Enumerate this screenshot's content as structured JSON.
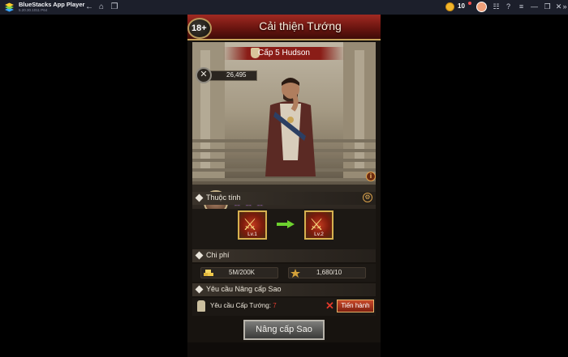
{
  "emulator": {
    "title": "BlueStacks App Player",
    "version": "5.20.30.1011 P64",
    "coins": "10",
    "nav_icons": [
      "back-icon",
      "home-icon",
      "multi-instance-icon"
    ],
    "controls": [
      "coin-icon",
      "notification-dot",
      "avatar",
      "menu-icon",
      "help-icon",
      "hamburger-icon",
      "minimize-icon",
      "restore-icon",
      "close-icon",
      "expand-icon"
    ]
  },
  "game": {
    "title": "Cải thiện Tướng",
    "age_rating": "18+",
    "hero": {
      "level_name": "Cấp 5 Hudson",
      "power": "26,495",
      "stars": 3
    },
    "attributes": {
      "header": "Thuộc tính",
      "from_level": "Lv.1",
      "to_level": "Lv.2"
    },
    "cost": {
      "header": "Chi phí",
      "gold": "5M/200K",
      "medals": "1,680/10"
    },
    "requirement": {
      "header": "Yêu cầu Nâng cấp Sao",
      "label": "Yêu cầu Cấp Tướng:",
      "level": "7",
      "proceed_label": "Tiến hành"
    },
    "upgrade_label": "Nâng cấp Sao"
  },
  "colors": {
    "header_red": "#8a1d17",
    "gold_border": "#c7a25a",
    "star_purple": "#a24be0",
    "requirement_red": "#e23b2e"
  }
}
